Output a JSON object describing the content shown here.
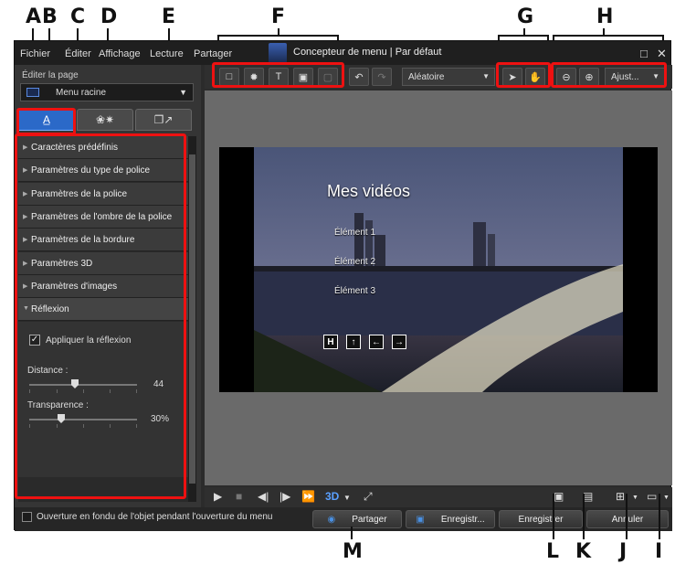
{
  "window": {
    "title": "Concepteur de menu | Par défaut",
    "menus": [
      "Fichier",
      "Éditer",
      "Affichage",
      "Lecture",
      "Partager"
    ]
  },
  "callouts": [
    "A",
    "B",
    "C",
    "D",
    "E",
    "F",
    "G",
    "H",
    "I",
    "J",
    "K",
    "L",
    "M"
  ],
  "left_panel": {
    "edit_page_label": "Éditer la page",
    "page_select": "Menu racine",
    "tabs": [
      "A̲",
      "❀✷",
      "❐↗"
    ],
    "sections": [
      "Caractères prédéfinis",
      "Paramètres du type de police",
      "Paramètres de la police",
      "Paramètres de l'ombre de la police",
      "Paramètres de la bordure",
      "Paramètres 3D",
      "Paramètres d'images",
      "Réflexion"
    ],
    "reflection": {
      "apply_label": "Appliquer la réflexion",
      "apply_checked": true,
      "distance_label": "Distance :",
      "distance_value": "44",
      "distance_level": 0.44,
      "transparency_label": "Transparence :",
      "transparency_value": "30%",
      "transparency_level": 0.3
    }
  },
  "toolbar": {
    "random_select": "Aléatoire",
    "zoom_select": "Ajust..."
  },
  "preview": {
    "title": "Mes vidéos",
    "items": [
      "Élément 1",
      "Élément 2",
      "Élément 3"
    ],
    "nav_buttons": [
      "H",
      "↑",
      "←",
      "→"
    ]
  },
  "playback": {
    "mode3d": "3D"
  },
  "bottom": {
    "fade_label": "Ouverture en fondu de l'objet pendant l'ouverture du menu",
    "share_label": "Partager",
    "save_as_label": "Enregistr...",
    "save_label": "Enregistrer",
    "cancel_label": "Annuler"
  },
  "colors": {
    "accent": "#2b69c8",
    "callout_box": "#e11111"
  }
}
